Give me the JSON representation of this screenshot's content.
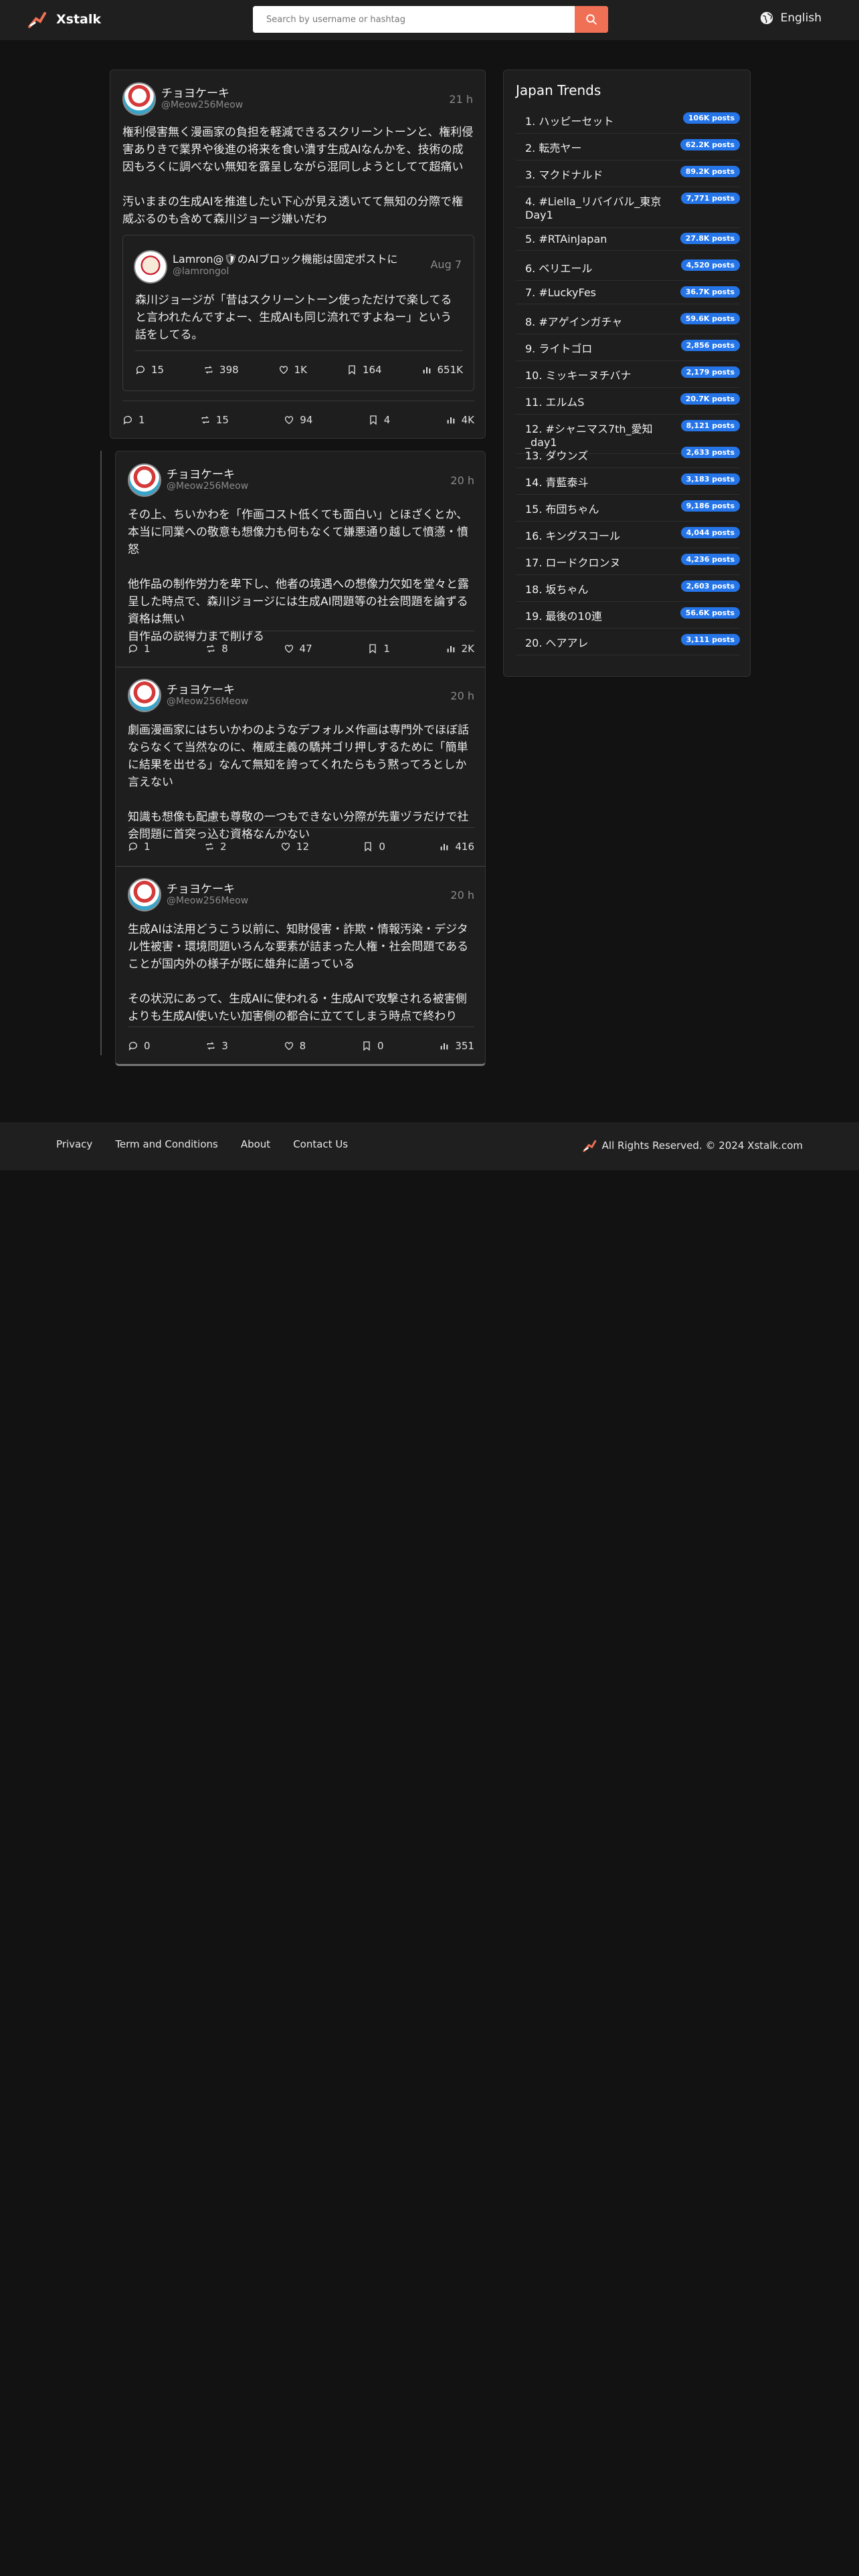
{
  "header": {
    "brand": "Xstalk",
    "search_placeholder": "Search by username or hashtag",
    "language": "English"
  },
  "main_post": {
    "name": "チョヨケーキ",
    "handle": "@Meow256Meow",
    "time": "21 h",
    "text": "権利侵害無く漫画家の負担を軽減できるスクリーントーンと、権利侵害ありきで業界や後進の将来を食い潰す生成AIなんかを、技術の成因もろくに調べない無知を露呈しながら混同しようとしてて超痛い\n\n汚いままの生成AIを推進したい下心が見え透いてて無知の分際で権威ぶるのも含めて森川ジョージ嫌いだわ",
    "quote": {
      "name": "Lamron@🛡のAIブロック機能は固定ポストに",
      "handle": "@lamrongol",
      "time": "Aug 7",
      "text": "森川ジョージが「昔はスクリーントーン使っただけで楽してると言われたんですよー、生成AIも同じ流れですよねー」という話をしてる。",
      "replies": "15",
      "reposts": "398",
      "likes": "1K",
      "bookmarks": "164",
      "views": "651K"
    },
    "replies": "1",
    "reposts": "15",
    "likes": "94",
    "bookmarks": "4",
    "views": "4K"
  },
  "thread": [
    {
      "name": "チョヨケーキ",
      "handle": "@Meow256Meow",
      "time": "20 h",
      "text": "その上、ちいかわを「作画コスト低くても面白い」とほざくとか、本当に同業への敬意も想像力も何もなくて嫌悪通り越して憤懣・憤怒\n\n他作品の制作労力を卑下し、他者の境遇への想像力欠如を堂々と露呈した時点で、森川ジョージには生成AI問題等の社会問題を論ずる資格は無い\n自作品の説得力まで削げる",
      "replies": "1",
      "reposts": "8",
      "likes": "47",
      "bookmarks": "1",
      "views": "2K"
    },
    {
      "name": "チョヨケーキ",
      "handle": "@Meow256Meow",
      "time": "20 h",
      "text": "劇画漫画家にはちいかわのようなデフォルメ作画は専門外でほぼ話ならなくて当然なのに、権威主義の驕丼ゴリ押しするために「簡単に結果を出せる」なんて無知を誇ってくれたらもう黙ってろとしか言えない\n\n知識も想像も配慮も尊敬の一つもできない分際が先輩ヅラだけで社会問題に首突っ込む資格なんかない",
      "replies": "1",
      "reposts": "2",
      "likes": "12",
      "bookmarks": "0",
      "views": "416"
    },
    {
      "name": "チョヨケーキ",
      "handle": "@Meow256Meow",
      "time": "20 h",
      "text": "生成AIは法用どうこう以前に、知財侵害・詐欺・情報汚染・デジタル性被害・環境問題いろんな要素が詰まった人権・社会問題であることが国内外の様子が既に雄弁に語っている\n\nその状況にあって、生成AIに使われる・生成AIで攻撃される被害側よりも生成AI使いたい加害側の都合に立ててしまう時点で終わり",
      "replies": "0",
      "reposts": "3",
      "likes": "8",
      "bookmarks": "0",
      "views": "351"
    }
  ],
  "trends": {
    "title": "Japan Trends",
    "items": [
      {
        "label": "1. ハッピーセット",
        "count": "106K posts"
      },
      {
        "label": "2. 転売ヤー",
        "count": "62.2K posts"
      },
      {
        "label": "3. マクドナルド",
        "count": "89.2K posts"
      },
      {
        "label": "4. #Liella_リバイバル_東京Day1",
        "count": "7,771 posts"
      },
      {
        "label": "5. #RTAinJapan",
        "count": "27.8K posts"
      },
      {
        "label": "6. ベリエール",
        "count": "4,520 posts"
      },
      {
        "label": "7. #LuckyFes",
        "count": "36.7K posts"
      },
      {
        "label": "8. #アゲインガチャ",
        "count": "59.6K posts"
      },
      {
        "label": "9. ライトゴロ",
        "count": "2,856 posts"
      },
      {
        "label": "10. ミッキーヌチバナ",
        "count": "2,179 posts"
      },
      {
        "label": "11. エルムS",
        "count": "20.7K posts"
      },
      {
        "label": "12. #シャニマス7th_愛知_day1",
        "count": "8,121 posts"
      },
      {
        "label": "13. ダウンズ",
        "count": "2,633 posts"
      },
      {
        "label": "14. 青藍泰斗",
        "count": "3,183 posts"
      },
      {
        "label": "15. 布団ちゃん",
        "count": "9,186 posts"
      },
      {
        "label": "16. キングスコール",
        "count": "4,044 posts"
      },
      {
        "label": "17. ロードクロンヌ",
        "count": "4,236 posts"
      },
      {
        "label": "18. 坂ちゃん",
        "count": "2,603 posts"
      },
      {
        "label": "19. 最後の10連",
        "count": "56.6K posts"
      },
      {
        "label": "20. ヘアアレ",
        "count": "3,111 posts"
      }
    ]
  },
  "footer": {
    "links": [
      "Privacy",
      "Term and Conditions",
      "About",
      "Contact Us"
    ],
    "copyright": "All Rights Reserved. © 2024 Xstalk.com"
  },
  "colors": {
    "background": "#121212",
    "card": "#1e1e1e",
    "accent": "#f07056",
    "badge": "#2575e8"
  }
}
